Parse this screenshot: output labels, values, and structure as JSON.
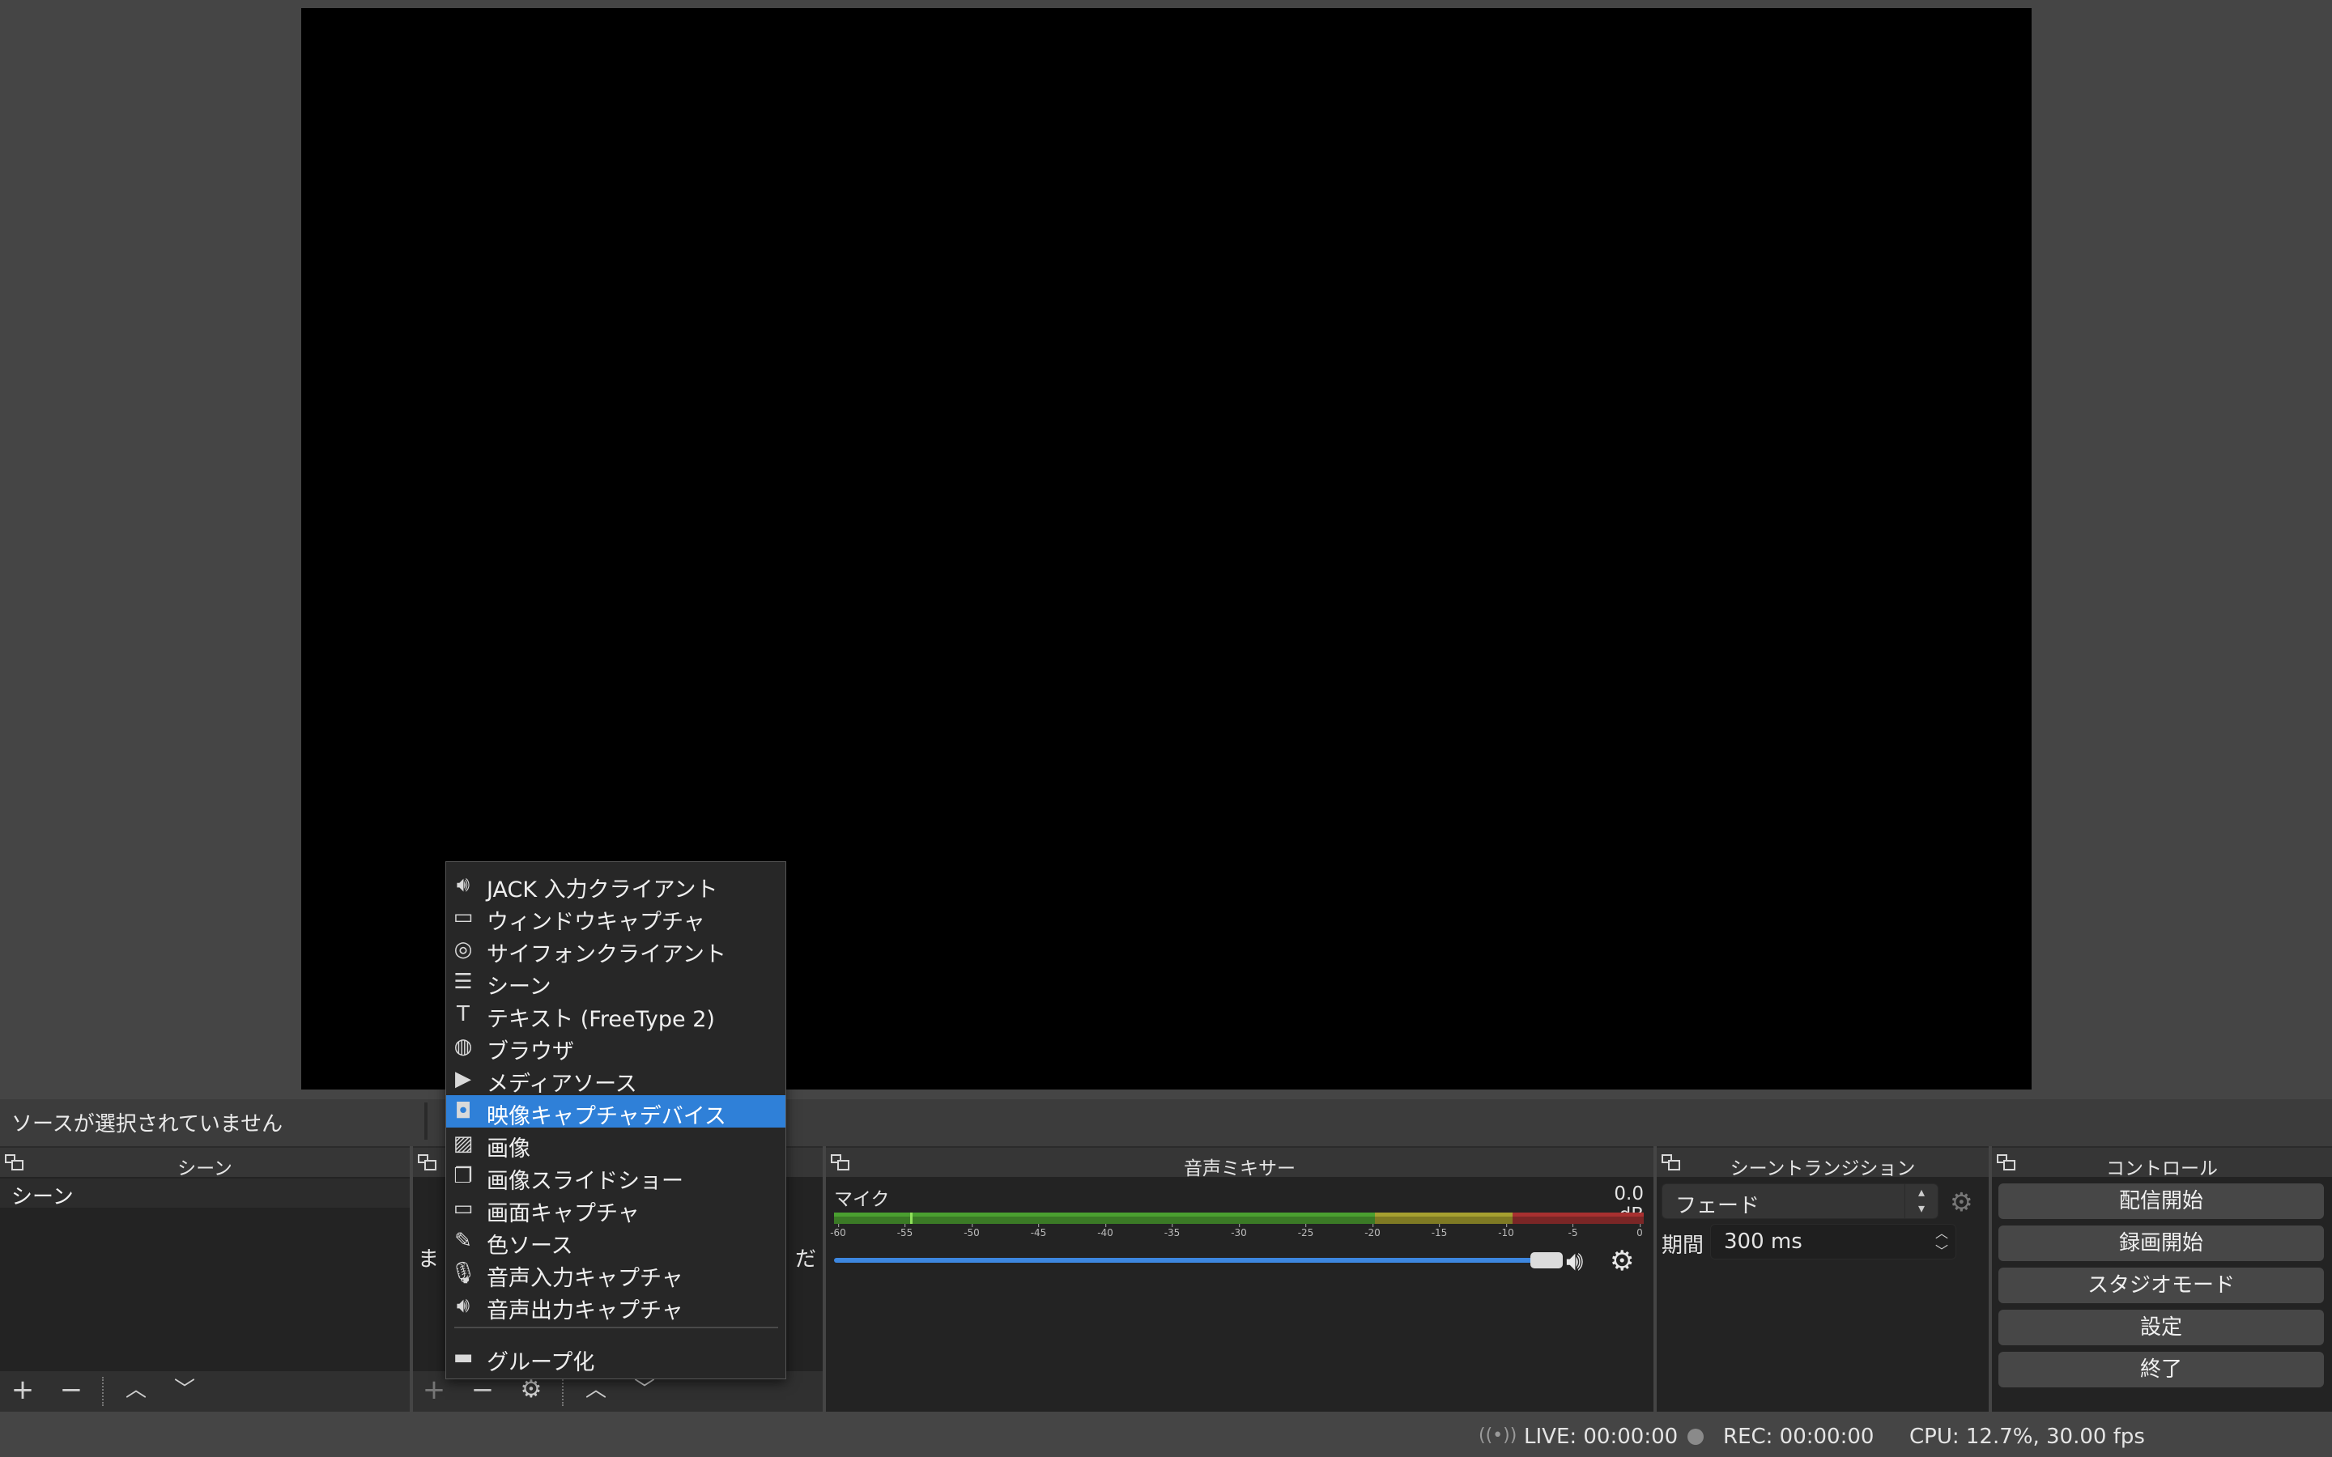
{
  "status": {
    "no_source": "ソースが選択されていません",
    "live": "LIVE: 00:00:00",
    "rec": "REC: 00:00:00",
    "cpu": "CPU: 12.7%, 30.00 fps"
  },
  "docks": {
    "scenes": {
      "title": "シーン",
      "items": [
        "シーン"
      ]
    },
    "sources": {
      "partial_left": "ま",
      "partial_right": "だ"
    },
    "mixer": {
      "title": "音声ミキサー",
      "track_name": "マイク",
      "level": "0.0 dB",
      "volume": 1.0,
      "ticks": [
        "-60",
        "-55",
        "-50",
        "-45",
        "-40",
        "-35",
        "-30",
        "-25",
        "-20",
        "-15",
        "-10",
        "-5",
        "0"
      ]
    },
    "transitions": {
      "title": "シーントランジション",
      "selected": "フェード",
      "duration_label": "期間",
      "duration_value": "300 ms"
    },
    "controls": {
      "title": "コントロール",
      "buttons": [
        "配信開始",
        "録画開始",
        "スタジオモード",
        "設定",
        "終了"
      ]
    }
  },
  "context_menu": {
    "items": [
      {
        "label": "JACK 入力クライアント",
        "icon": "speaker-icon"
      },
      {
        "label": "ウィンドウキャプチャ",
        "icon": "window-icon"
      },
      {
        "label": "サイフォンクライアント",
        "icon": "gamepad-icon"
      },
      {
        "label": "シーン",
        "icon": "list-icon"
      },
      {
        "label": "テキスト (FreeType 2)",
        "icon": "text-icon"
      },
      {
        "label": "ブラウザ",
        "icon": "globe-icon"
      },
      {
        "label": "メディアソース",
        "icon": "play-icon"
      },
      {
        "label": "映像キャプチャデバイス",
        "icon": "camera-icon",
        "selected": true
      },
      {
        "label": "画像",
        "icon": "image-icon"
      },
      {
        "label": "画像スライドショー",
        "icon": "slideshow-icon"
      },
      {
        "label": "画面キャプチャ",
        "icon": "monitor-icon"
      },
      {
        "label": "色ソース",
        "icon": "brush-icon"
      },
      {
        "label": "音声入力キャプチャ",
        "icon": "microphone-icon"
      },
      {
        "label": "音声出力キャプチャ",
        "icon": "speaker-icon"
      },
      {
        "label": "グループ化",
        "icon": "folder-icon"
      }
    ]
  },
  "colors": {
    "accent": "#2f80d8",
    "volume": "#3d87e0"
  }
}
